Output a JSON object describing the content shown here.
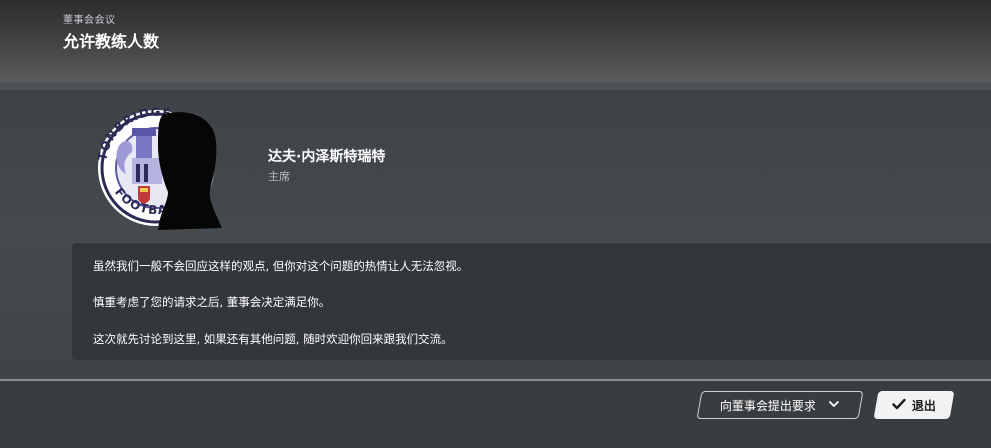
{
  "header": {
    "breadcrumb": "董事会会议",
    "title": "允许教练人数"
  },
  "speaker": {
    "name": "达夫·内泽斯特瑞特",
    "role": "主席",
    "crest_text_top": "TONBRIDGE A",
    "crest_text_bottom": "FOOTBALL C"
  },
  "message": {
    "lines": [
      "虽然我们一般不会回应这样的观点, 但你对这个问题的热情让人无法忽视。",
      "慎重考虑了您的请求之后, 董事会决定满足你。",
      "这次就先讨论到这里, 如果还有其他问题, 随时欢迎你回来跟我们交流。"
    ]
  },
  "footer": {
    "request_label": "向董事会提出要求",
    "exit_label": "退出"
  },
  "colors": {
    "accent_light": "#f1f2f3",
    "panel": "#33373b",
    "crest_purple": "#7a76c4"
  },
  "icons": {
    "dropdown": "chevron-down-icon",
    "exit": "check-icon"
  }
}
